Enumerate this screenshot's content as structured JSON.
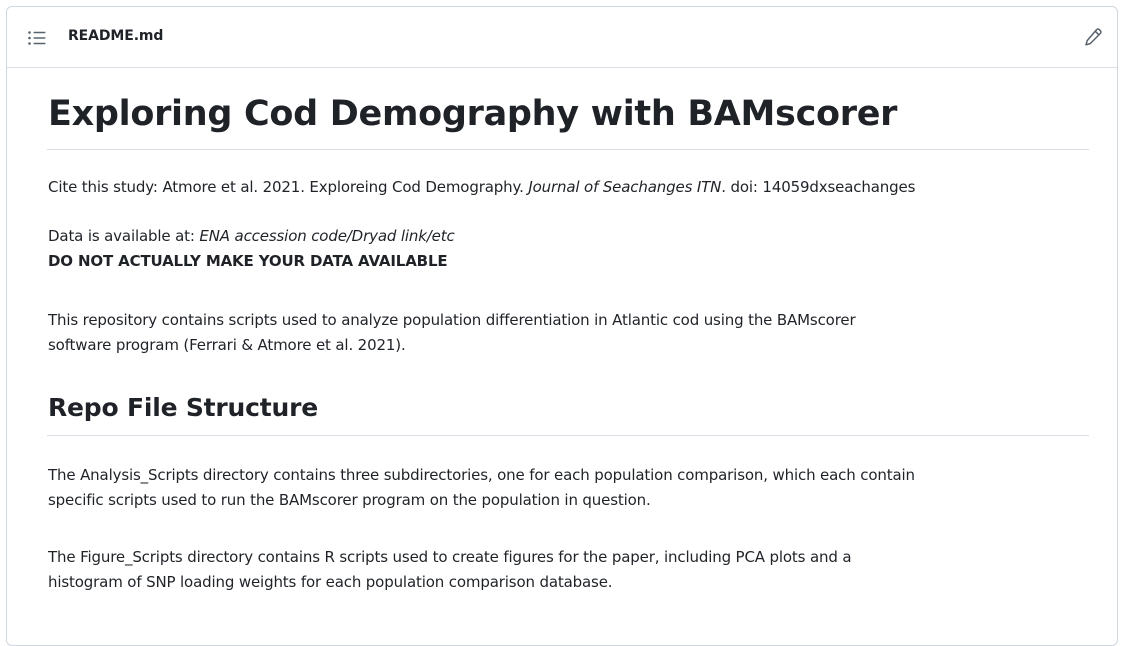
{
  "header": {
    "filename": "README.md",
    "toc_icon": "list-unordered-icon",
    "edit_icon": "pencil-icon"
  },
  "readme": {
    "title": "Exploring Cod Demography with BAMscorer",
    "cite": {
      "prefix": "Cite this study: Atmore et al. 2021. Exploreing Cod Demography. ",
      "journal": "Journal of Seachanges ITN",
      "suffix": ". doi: 14059dxseachanges"
    },
    "data_available": {
      "prefix": "Data is available at: ",
      "location": "ENA accession code/Dryad link/etc",
      "warning": "DO NOT ACTUALLY MAKE YOUR DATA AVAILABLE"
    },
    "repo_description": {
      "line1": "This repository contains scripts used to analyze population differentiation in Atlantic cod using the BAMscorer",
      "line2": "software program (Ferrari & Atmore et al. 2021)."
    },
    "section_heading": "Repo File Structure",
    "analysis_scripts": {
      "line1": "The Analysis_Scripts directory contains three subdirectories, one for each population comparison, which each contain",
      "line2": "specific scripts used to run the BAMscorer program on the population in question."
    },
    "figure_scripts": {
      "line1": "The Figure_Scripts directory contains R scripts used to create figures for the paper, including PCA plots and a",
      "line2": "histogram of SNP loading weights for each population comparison database."
    }
  },
  "colors": {
    "text": "#1f2328",
    "border": "#d0d7de",
    "rule": "#d8dee4",
    "icon": "#59636e"
  }
}
